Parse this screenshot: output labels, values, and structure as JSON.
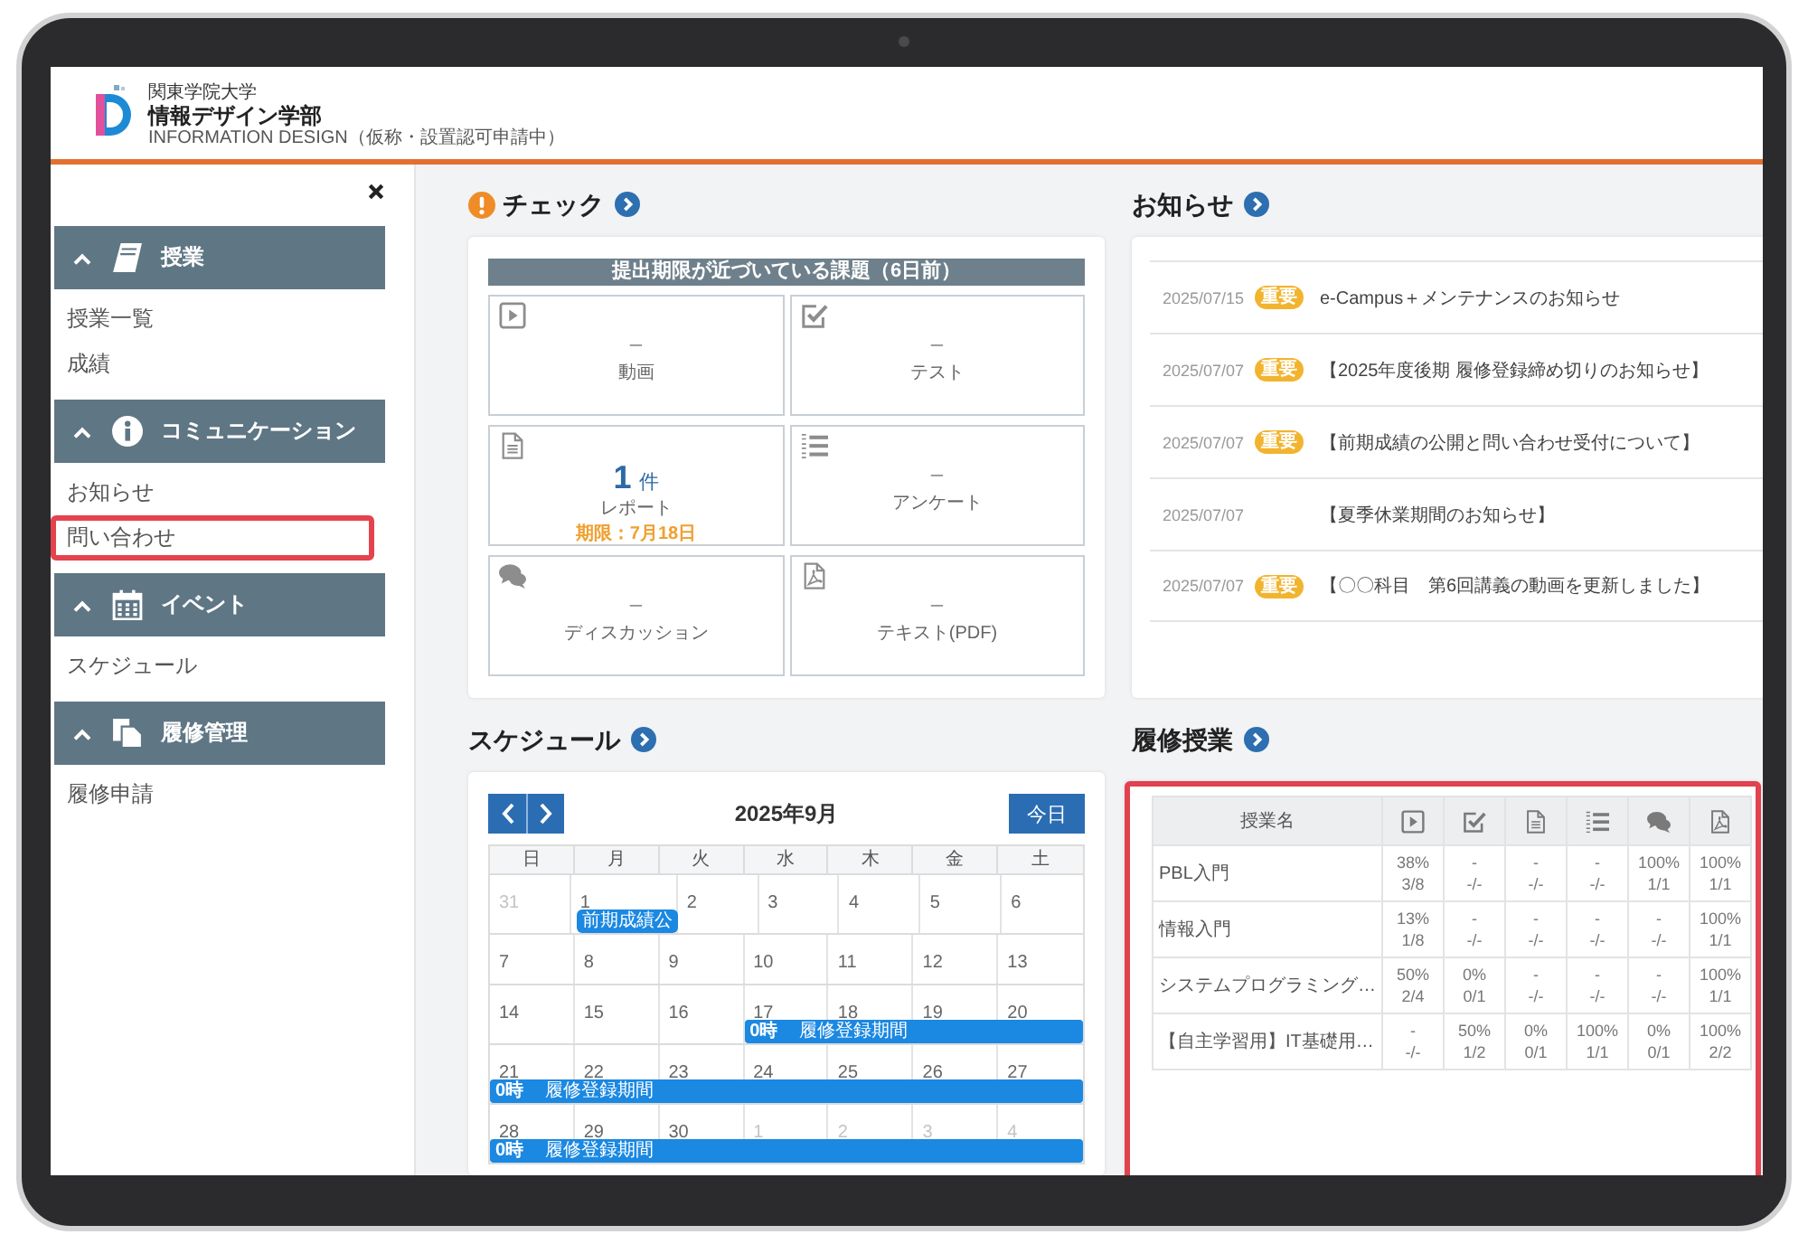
{
  "header": {
    "logo": {
      "university": "関東学院大学",
      "faculty": "情報デザイン学部",
      "subtitle": "INFORMATION DESIGN（仮称・設置認可申請中）"
    }
  },
  "sidebar": {
    "sections": [
      {
        "title": "授業",
        "expanded": true,
        "items": [
          {
            "label": "授業一覧",
            "highlighted": false
          },
          {
            "label": "成績",
            "highlighted": false
          }
        ]
      },
      {
        "title": "コミュニケーション",
        "expanded": true,
        "items": [
          {
            "label": "お知らせ",
            "highlighted": false
          },
          {
            "label": "問い合わせ",
            "highlighted": true
          }
        ]
      },
      {
        "title": "イベント",
        "expanded": true,
        "items": [
          {
            "label": "スケジュール",
            "highlighted": false
          }
        ]
      },
      {
        "title": "履修管理",
        "expanded": true,
        "items": [
          {
            "label": "履修申請",
            "highlighted": false
          }
        ]
      }
    ]
  },
  "check": {
    "title": "チェック",
    "highlighted": false,
    "banner": "提出期限が近づいている課題（6日前）",
    "tiles": [
      {
        "count": "–",
        "label": "動画"
      },
      {
        "count": "–",
        "label": "テスト"
      },
      {
        "count": "1",
        "unit": "件",
        "label": "レポート",
        "deadline": "期限：7月18日"
      },
      {
        "count": "–",
        "label": "アンケート"
      },
      {
        "count": "–",
        "label": "ディスカッション"
      },
      {
        "count": "–",
        "label": "テキスト(PDF)"
      }
    ]
  },
  "notices": {
    "title": "お知らせ",
    "highlighted": false,
    "items": [
      {
        "date": "2025/07/15",
        "badge": "重要",
        "title": "e-Campus＋メンテナンスのお知らせ"
      },
      {
        "date": "2025/07/07",
        "badge": "重要",
        "title": "【2025年度後期 履修登録締め切りのお知らせ】"
      },
      {
        "date": "2025/07/07",
        "badge": "重要",
        "title": "【前期成績の公開と問い合わせ受付について】"
      },
      {
        "date": "2025/07/07",
        "title": "【夏季休業期間のお知らせ】"
      },
      {
        "date": "2025/07/07",
        "badge": "重要",
        "title": "【〇〇科目　第6回講義の動画を更新しました】"
      }
    ]
  },
  "schedule": {
    "title": "スケジュール",
    "highlighted": false,
    "month": "2025年9月",
    "today_button": "今日",
    "weekdays": [
      "日",
      "月",
      "火",
      "水",
      "木",
      "金",
      "土"
    ],
    "weeks": [
      {
        "days": [
          {
            "day": "31",
            "outside": true
          },
          {
            "day": "1",
            "outside": false,
            "event": {
              "title": "前期成績公",
              "to_week_end": false
            }
          },
          {
            "day": "2",
            "outside": false
          },
          {
            "day": "3",
            "outside": false
          },
          {
            "day": "4",
            "outside": false
          },
          {
            "day": "5",
            "outside": false
          },
          {
            "day": "6",
            "outside": false
          }
        ]
      },
      {
        "days": [
          {
            "day": "7",
            "outside": false
          },
          {
            "day": "8",
            "outside": false
          },
          {
            "day": "9",
            "outside": false
          },
          {
            "day": "10",
            "outside": false
          },
          {
            "day": "11",
            "outside": false
          },
          {
            "day": "12",
            "outside": false
          },
          {
            "day": "13",
            "outside": false
          }
        ]
      },
      {
        "days": [
          {
            "day": "14",
            "outside": false
          },
          {
            "day": "15",
            "outside": false
          },
          {
            "day": "16",
            "outside": false
          },
          {
            "day": "17",
            "outside": false,
            "event": {
              "time": "0時",
              "title": "履修登録期間",
              "to_week_end": true
            }
          },
          {
            "day": "18",
            "outside": false
          },
          {
            "day": "19",
            "outside": false
          },
          {
            "day": "20",
            "outside": false
          }
        ]
      },
      {
        "days": [
          {
            "day": "21",
            "outside": false,
            "event": {
              "time": "0時",
              "title": "履修登録期間",
              "to_week_end": true
            }
          },
          {
            "day": "22",
            "outside": false
          },
          {
            "day": "23",
            "outside": false
          },
          {
            "day": "24",
            "outside": false
          },
          {
            "day": "25",
            "outside": false
          },
          {
            "day": "26",
            "outside": false
          },
          {
            "day": "27",
            "outside": false
          }
        ]
      },
      {
        "days": [
          {
            "day": "28",
            "outside": false,
            "event": {
              "time": "0時",
              "title": "履修登録期間",
              "to_week_end": true
            }
          },
          {
            "day": "29",
            "outside": false
          },
          {
            "day": "30",
            "outside": false
          },
          {
            "day": "1",
            "outside": true
          },
          {
            "day": "2",
            "outside": true
          },
          {
            "day": "3",
            "outside": true
          },
          {
            "day": "4",
            "outside": true
          }
        ]
      }
    ]
  },
  "courses": {
    "title": "履修授業",
    "highlighted": true,
    "name_header": "授業名",
    "rows": [
      {
        "name": "PBL入門",
        "cells": [
          {
            "rate": "38%",
            "count": "3/8"
          },
          {
            "rate": "-",
            "count": "-/-"
          },
          {
            "rate": "-",
            "count": "-/-"
          },
          {
            "rate": "-",
            "count": "-/-"
          },
          {
            "rate": "100%",
            "count": "1/1"
          },
          {
            "rate": "100%",
            "count": "1/1"
          }
        ]
      },
      {
        "name": "情報入門",
        "cells": [
          {
            "rate": "13%",
            "count": "1/8"
          },
          {
            "rate": "-",
            "count": "-/-"
          },
          {
            "rate": "-",
            "count": "-/-"
          },
          {
            "rate": "-",
            "count": "-/-"
          },
          {
            "rate": "-",
            "count": "-/-"
          },
          {
            "rate": "100%",
            "count": "1/1"
          }
        ]
      },
      {
        "name": "システムプログラミング…",
        "cells": [
          {
            "rate": "50%",
            "count": "2/4"
          },
          {
            "rate": "0%",
            "count": "0/1"
          },
          {
            "rate": "-",
            "count": "-/-"
          },
          {
            "rate": "-",
            "count": "-/-"
          },
          {
            "rate": "-",
            "count": "-/-"
          },
          {
            "rate": "100%",
            "count": "1/1"
          }
        ]
      },
      {
        "name": "【自主学習用】IT基礎用…",
        "cells": [
          {
            "rate": "-",
            "count": "-/-"
          },
          {
            "rate": "50%",
            "count": "1/2"
          },
          {
            "rate": "0%",
            "count": "0/1"
          },
          {
            "rate": "100%",
            "count": "1/1"
          },
          {
            "rate": "0%",
            "count": "0/1"
          },
          {
            "rate": "100%",
            "count": "2/2"
          }
        ]
      }
    ]
  }
}
